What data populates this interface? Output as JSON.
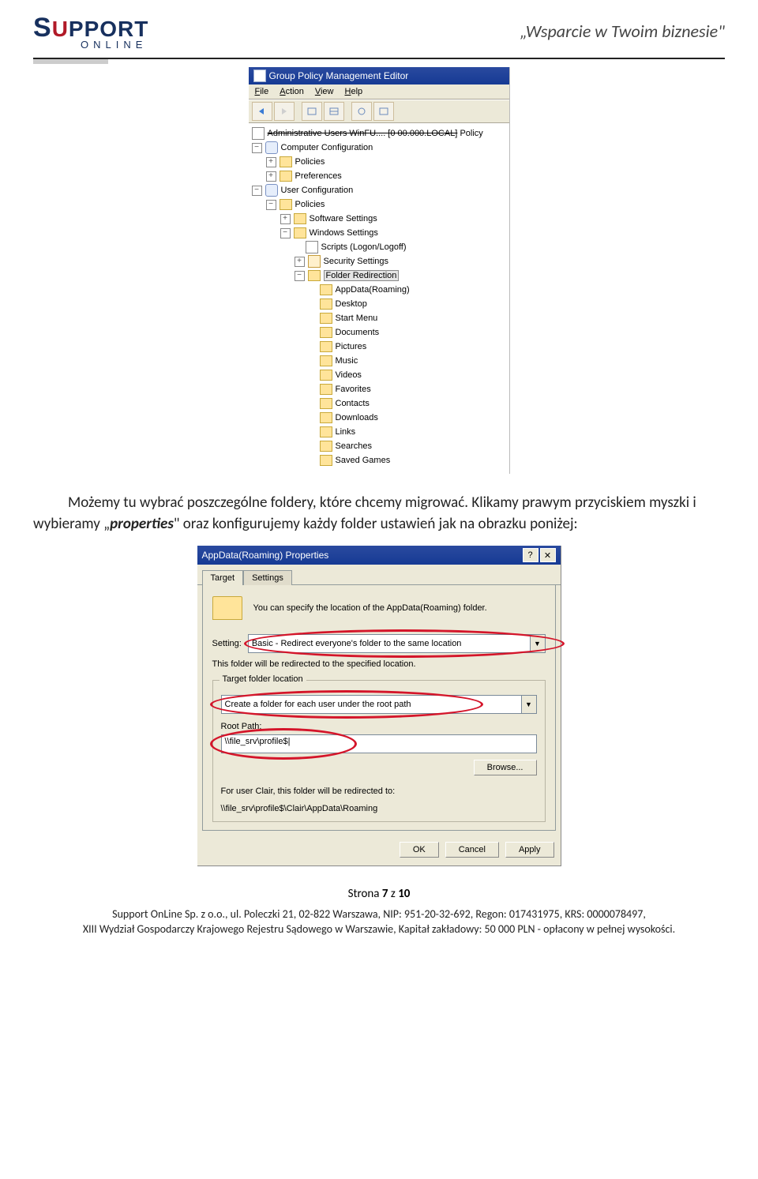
{
  "header": {
    "logo_support": "SUPPORT",
    "logo_online": "ONLINE",
    "tagline": "„Wsparcie w Twoim biznesie\""
  },
  "gp": {
    "title": "Group Policy Management Editor",
    "menu": {
      "file": "File",
      "action": "Action",
      "view": "View",
      "help": "Help"
    },
    "root_suffix": "Policy",
    "nodes": {
      "comp_conf": "Computer Configuration",
      "policies": "Policies",
      "preferences": "Preferences",
      "user_conf": "User Configuration",
      "software": "Software Settings",
      "windows": "Windows Settings",
      "scripts": "Scripts (Logon/Logoff)",
      "security": "Security Settings",
      "folder_redir": "Folder Redirection",
      "appdata": "AppData(Roaming)",
      "desktop": "Desktop",
      "startmenu": "Start Menu",
      "documents": "Documents",
      "pictures": "Pictures",
      "music": "Music",
      "videos": "Videos",
      "favorites": "Favorites",
      "contacts": "Contacts",
      "downloads": "Downloads",
      "links": "Links",
      "searches": "Searches",
      "savedgames": "Saved Games"
    }
  },
  "body": {
    "p1a": "Możemy tu wybrać poszczególne foldery, które chcemy migrować. Klikamy prawym przyciskiem myszki i wybieramy „",
    "p1i": "properties",
    "p1b": "\" oraz konfigurujemy każdy folder ustawień jak na obrazku poniżej:"
  },
  "props": {
    "title": "AppData(Roaming) Properties",
    "tab_target": "Target",
    "tab_settings": "Settings",
    "info": "You can specify the location of the AppData(Roaming) folder.",
    "setting_lbl": "Setting:",
    "setting_val": "Basic - Redirect everyone's folder to the same location",
    "redir_note": "This folder will be redirected to the specified location.",
    "grp_title": "Target folder location",
    "target_val": "Create a folder for each user under the root path",
    "root_lbl": "Root Path:",
    "root_val": "\\\\file_srv\\profile$|",
    "browse": "Browse...",
    "for_user": "For user Clair, this folder will be redirected to:",
    "result": "\\\\file_srv\\profile$\\Clair\\AppData\\Roaming",
    "ok": "OK",
    "cancel": "Cancel",
    "apply": "Apply"
  },
  "footer": {
    "page": "Strona 7 z 10",
    "legal1": "Support OnLine Sp. z o.o., ul. Poleczki 21, 02-822 Warszawa, NIP: 951-20-32-692, Regon: 017431975, KRS: 0000078497,",
    "legal2": "XIII Wydział Gospodarczy Krajowego Rejestru Sądowego w Warszawie, Kapitał zakładowy: 50 000 PLN - opłacony w pełnej wysokości."
  }
}
